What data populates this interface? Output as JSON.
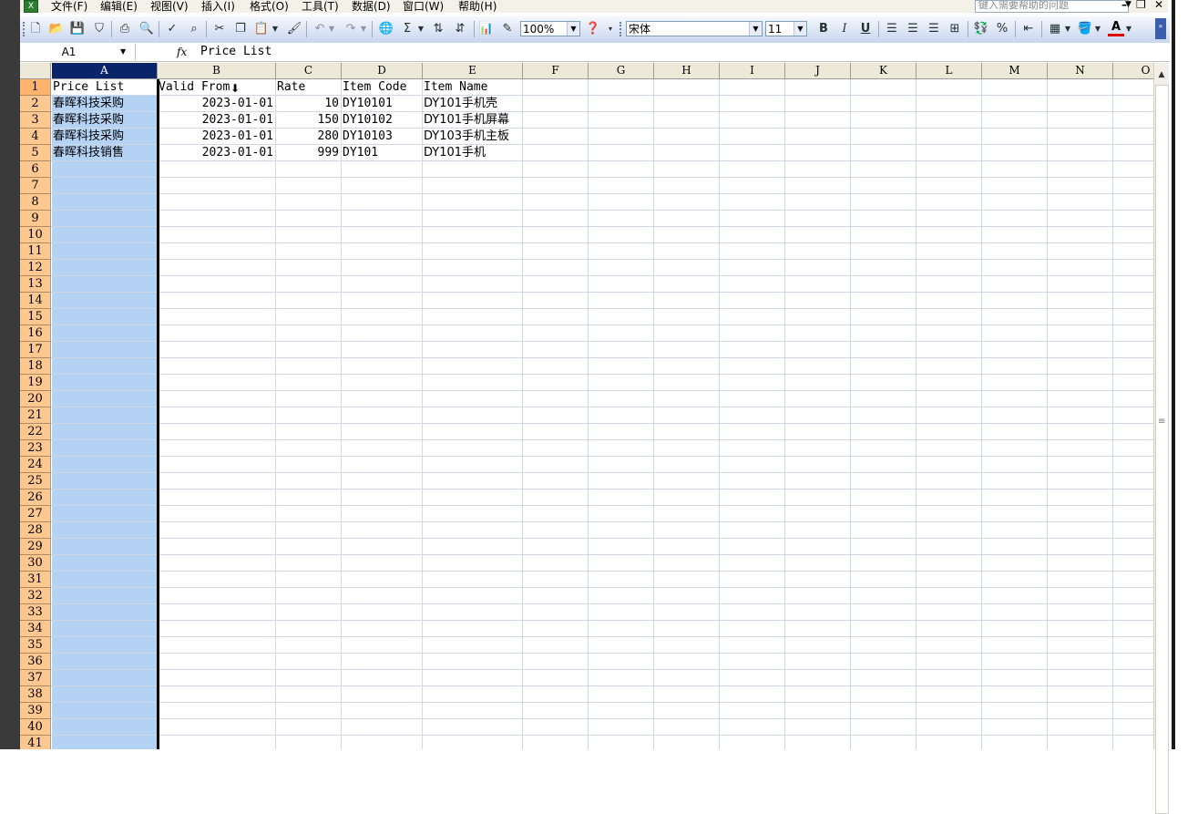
{
  "menu": {
    "items": [
      "文件(F)",
      "编辑(E)",
      "视图(V)",
      "插入(I)",
      "格式(O)",
      "工具(T)",
      "数据(D)",
      "窗口(W)",
      "帮助(H)"
    ],
    "help_placeholder": "键入需要帮助的问题"
  },
  "toolbar": {
    "zoom": "100%",
    "font_name": "宋体",
    "font_size": "11",
    "bold": "B",
    "italic": "I",
    "underline": "U",
    "percent": "%",
    "font_color": "A",
    "sigma": "Σ"
  },
  "formula_bar": {
    "name_box": "A1",
    "fx": "fx",
    "content": "Price List"
  },
  "columns": [
    "A",
    "B",
    "C",
    "D",
    "E",
    "F",
    "G",
    "H",
    "I",
    "J",
    "K",
    "L",
    "M",
    "N",
    "O"
  ],
  "rows": [
    "1",
    "2",
    "3",
    "4",
    "5",
    "6",
    "7",
    "8",
    "9",
    "10",
    "11",
    "12",
    "13",
    "14",
    "15",
    "16",
    "17",
    "18",
    "19",
    "20",
    "21",
    "22",
    "23",
    "24",
    "25",
    "26",
    "27",
    "28",
    "29",
    "30",
    "31",
    "32",
    "33",
    "34",
    "35",
    "36",
    "37",
    "38",
    "39",
    "40",
    "41"
  ],
  "sheet": {
    "headers": [
      "Price List",
      "Valid From",
      "Rate",
      "Item Code",
      "Item Name"
    ],
    "data": [
      [
        "春晖科技采购",
        "2023-01-01",
        "10",
        "DY10101",
        "DY101手机壳"
      ],
      [
        "春晖科技采购",
        "2023-01-01",
        "150",
        "DY10102",
        "DY101手机屏幕"
      ],
      [
        "春晖科技采购",
        "2023-01-01",
        "280",
        "DY10103",
        "DY103手机主板"
      ],
      [
        "春晖科技销售",
        "2023-01-01",
        "999",
        "DY101",
        "DY101手机"
      ]
    ]
  },
  "colors": {
    "selected_column_header": "#0a246a",
    "selected_column_fill": "#b4d2f4",
    "row_header": "#ffc890",
    "toolbar": "#c8d6f0"
  }
}
